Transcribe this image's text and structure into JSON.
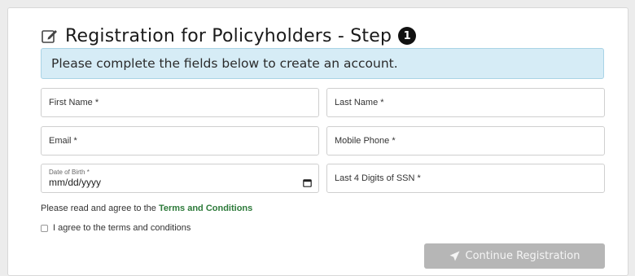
{
  "header": {
    "title": "Registration for Policyholders - Step",
    "step_number": "1",
    "icon": "edit-icon"
  },
  "banner": {
    "text": "Please complete the fields below to create an account."
  },
  "fields": {
    "first_name": {
      "label": "First Name *"
    },
    "last_name": {
      "label": "Last Name *"
    },
    "email": {
      "label": "Email *"
    },
    "mobile_phone": {
      "label": "Mobile Phone *"
    },
    "date_of_birth": {
      "label": "Date of Birth *",
      "value": "mm/dd/yyyy",
      "icon": "calendar-icon"
    },
    "ssn_last4": {
      "label": "Last 4 Digits of SSN *"
    }
  },
  "terms": {
    "prefix": "Please read and agree to the ",
    "link_text": "Terms and Conditions",
    "checkbox_label": "I agree to the terms and conditions",
    "checked": false
  },
  "actions": {
    "continue_label": "Continue Registration",
    "continue_icon": "paper-plane-icon",
    "continue_enabled": false
  },
  "colors": {
    "banner_bg": "#d6ecf6",
    "banner_border": "#a9d3e6",
    "link_green": "#2d7a3a",
    "button_disabled": "#b6b6b6"
  }
}
